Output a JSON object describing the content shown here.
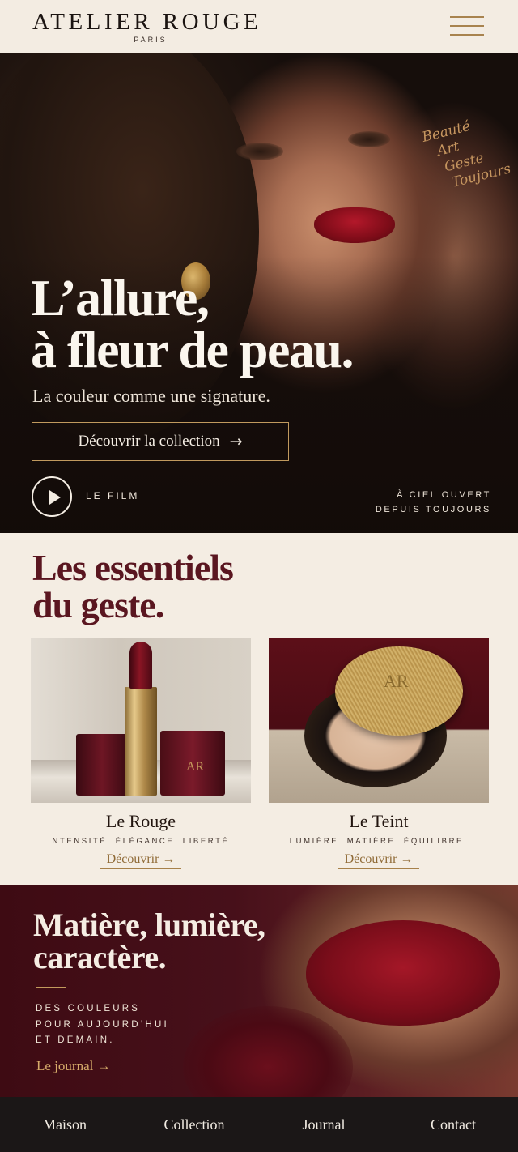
{
  "brand": {
    "name": "ATELIER ROUGE",
    "city": "PARIS"
  },
  "header": {
    "menu_icon": "hamburger-menu-icon"
  },
  "hero": {
    "script_words": [
      "Beauté",
      "Art",
      "Geste",
      "Toujours"
    ],
    "title_line1": "L’allure,",
    "title_line2": "à fleur de peau.",
    "subtitle": "La couleur comme une signature.",
    "cta_label": "Découvrir la collection",
    "cta_arrow": "→",
    "play_icon": "play-icon",
    "film_label": "LE FILM",
    "corner_line1": "À CIEL OUVERT",
    "corner_line2": "DEPUIS TOUJOURS"
  },
  "essentials": {
    "title_line1": "Les essentiels",
    "title_line2": "du geste.",
    "cards": [
      {
        "name": "Le Rouge",
        "tagline": "INTENSITÉ. ÉLÉGANCE. LIBERTÉ.",
        "link": "Découvrir →",
        "monogram": "AR"
      },
      {
        "name": "Le Teint",
        "tagline": "LUMIÈRE. MATIÈRE. ÉQUILIBRE.",
        "link": "Découvrir →",
        "monogram": "AR"
      }
    ]
  },
  "promo": {
    "title_line1": "Matière, lumière,",
    "title_line2": "caractère.",
    "text_line1": "DES COULEURS",
    "text_line2": "POUR AUJOURD’HUI",
    "text_line3": "ET DEMAIN.",
    "link": "Le journal →"
  },
  "bottom_nav": [
    "Maison",
    "Collection",
    "Journal",
    "Contact"
  ],
  "colors": {
    "gold": "#c19a5e",
    "burgundy": "#5a1620",
    "cream": "#f4ede3",
    "nav_bg": "#1b1717"
  }
}
